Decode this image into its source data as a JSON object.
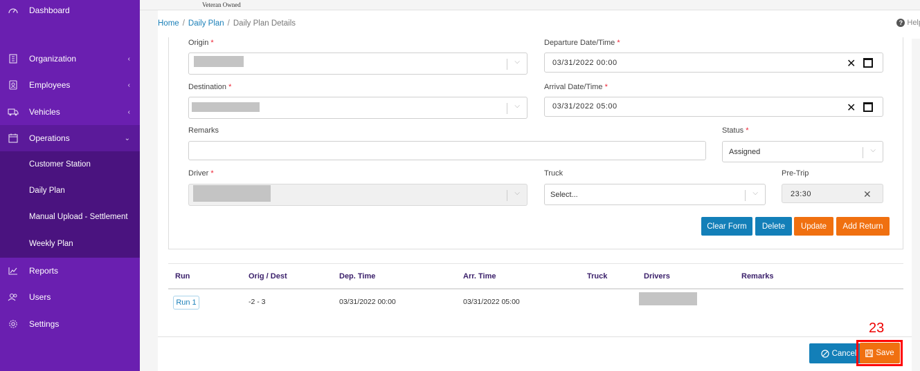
{
  "sidebar": {
    "items": [
      {
        "label": "Dashboard",
        "icon": "gauge-icon"
      },
      {
        "label": "Organization",
        "icon": "building-icon",
        "chevron": "‹"
      },
      {
        "label": "Employees",
        "icon": "id-badge-icon",
        "chevron": "‹"
      },
      {
        "label": "Vehicles",
        "icon": "truck-icon",
        "chevron": "‹"
      },
      {
        "label": "Operations",
        "icon": "calendar-icon",
        "chevron": "⌄"
      },
      {
        "label": "Reports",
        "icon": "chart-line-icon"
      },
      {
        "label": "Users",
        "icon": "users-icon"
      },
      {
        "label": "Settings",
        "icon": "gear-icon"
      }
    ],
    "subitems": [
      "Customer Station",
      "Daily Plan",
      "Manual Upload - Settlement",
      "Weekly Plan"
    ]
  },
  "logo": {
    "tagline": "Veteran Owned"
  },
  "breadcrumb": {
    "home": "Home",
    "daily_plan": "Daily Plan",
    "current": "Daily Plan Details",
    "sep": "/"
  },
  "help": {
    "label": "Help",
    "glyph": "?"
  },
  "form": {
    "origin_label": "Origin",
    "destination_label": "Destination",
    "departure_label": "Departure Date/Time",
    "departure_value": "03/31/2022 00:00",
    "arrival_label": "Arrival Date/Time",
    "arrival_value": "03/31/2022 05:00",
    "remarks_label": "Remarks",
    "status_label": "Status",
    "status_value": "Assigned",
    "driver_label": "Driver",
    "truck_label": "Truck",
    "truck_placeholder": "Select...",
    "pretrip_label": "Pre-Trip",
    "pretrip_value": "23:30",
    "required_mark": "*"
  },
  "buttons": {
    "clear": "Clear Form",
    "delete": "Delete",
    "update": "Update",
    "add_return": "Add Return",
    "cancel": "Cancel",
    "save": "Save"
  },
  "table": {
    "headers": [
      "Run",
      "Orig / Dest",
      "Dep. Time",
      "Arr. Time",
      "Truck",
      "Drivers",
      "Remarks"
    ],
    "rows": [
      {
        "run": "Run 1",
        "orig_dest": "-2 - 3",
        "dep": "03/31/2022 00:00",
        "arr": "03/31/2022 05:00",
        "truck": "",
        "remarks": ""
      }
    ]
  },
  "annotation": {
    "marker": "23"
  },
  "colors": {
    "sidebar": "#6a1fb0",
    "primary": "#137fb8",
    "accent": "#f07010",
    "highlight": "#ff0000"
  }
}
